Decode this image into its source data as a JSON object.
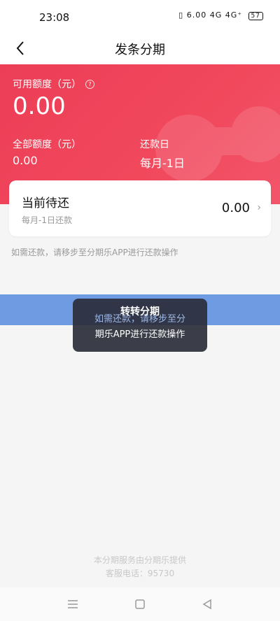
{
  "status_bar": {
    "time": "23:08",
    "indicators": "▯ 6.00 4G 4G⁺",
    "battery": "57"
  },
  "header": {
    "title": "发条分期"
  },
  "credit": {
    "available_label": "可用额度（元）",
    "available_value": "0.00",
    "total_label": "全部额度（元）",
    "total_value": "0.00",
    "due_label": "还款日",
    "due_value": "每月-1日"
  },
  "pending": {
    "title": "当前待还",
    "subtitle": "每月-1日还款",
    "amount": "0.00"
  },
  "notice": "如需还款，请移步至分期乐APP进行还款操作",
  "toast": {
    "title": "转转分期",
    "line1": "如需还款，请移步至分",
    "line2": "期乐APP进行还款操作"
  },
  "footer": {
    "line1": "本分期服务由分期乐提供",
    "line2": "客服电话：95730"
  },
  "colors": {
    "brand_red": "#ec3e57",
    "blue_bar": "#6f9be3"
  },
  "icons": {
    "back": "chevron-left-icon",
    "help": "question-circle-icon",
    "more": "chevron-right-icon",
    "nav_menu": "menu-icon",
    "nav_home": "square-icon",
    "nav_back": "triangle-back-icon"
  }
}
